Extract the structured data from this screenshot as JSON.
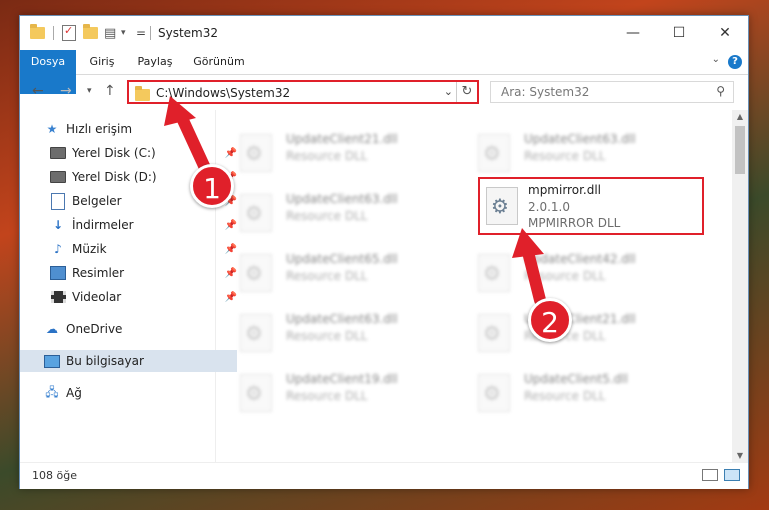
{
  "window": {
    "title": "System32",
    "minimize_glyph": "—",
    "maximize_glyph": "☐",
    "close_glyph": "✕"
  },
  "ribbon": {
    "tabs": [
      "Dosya",
      "Giriş",
      "Paylaş",
      "Görünüm"
    ],
    "help_label": "?",
    "accent_color": "#1979ca"
  },
  "navigation": {
    "address_path": "C:\\Windows\\System32",
    "search_placeholder": "Ara: System32"
  },
  "sidebar": {
    "items": [
      {
        "label": "Hızlı erişim",
        "icon": "star-icon",
        "pinned": false
      },
      {
        "label": "Yerel Disk (C:)",
        "icon": "disk-icon",
        "pinned": true
      },
      {
        "label": "Yerel Disk (D:)",
        "icon": "disk-icon",
        "pinned": true
      },
      {
        "label": "Belgeler",
        "icon": "documents-icon",
        "pinned": true
      },
      {
        "label": "İndirmeler",
        "icon": "download-icon",
        "pinned": true
      },
      {
        "label": "Müzik",
        "icon": "music-icon",
        "pinned": true
      },
      {
        "label": "Resimler",
        "icon": "pictures-icon",
        "pinned": true
      },
      {
        "label": "Videolar",
        "icon": "videos-icon",
        "pinned": true
      },
      {
        "label": "OneDrive",
        "icon": "cloud-icon",
        "pinned": false
      },
      {
        "label": "Bu bilgisayar",
        "icon": "computer-icon",
        "pinned": false,
        "selected": true
      },
      {
        "label": "Ağ",
        "icon": "network-icon",
        "pinned": false
      }
    ]
  },
  "files": {
    "left_column": [
      {
        "name": "UpdateClient21.dll",
        "type": "Resource DLL"
      },
      {
        "name": "UpdateClient63.dll",
        "type": "Resource DLL"
      },
      {
        "name": "UpdateClient65.dll",
        "type": "Resource DLL"
      },
      {
        "name": "UpdateClient63.dll",
        "type": "Resource DLL"
      },
      {
        "name": "UpdateClient19.dll",
        "type": "Resource DLL"
      }
    ],
    "right_column": [
      {
        "name": "UpdateClient63.dll",
        "type": "Resource DLL"
      },
      {
        "name": "UpdateClient42.dll",
        "type": "Resource DLL"
      },
      {
        "name": "UpdateClient21.dll",
        "type": "Resource DLL"
      },
      {
        "name": "UpdateClient5.dll",
        "type": "Resource DLL"
      }
    ],
    "highlighted": {
      "name": "mpmirror.dll",
      "version": "2.0.1.0",
      "description": "MPMIRROR DLL"
    }
  },
  "status": {
    "item_count": "108 öğe"
  },
  "annotations": {
    "step_1": "1",
    "step_2": "2",
    "color": "#e0202a"
  }
}
